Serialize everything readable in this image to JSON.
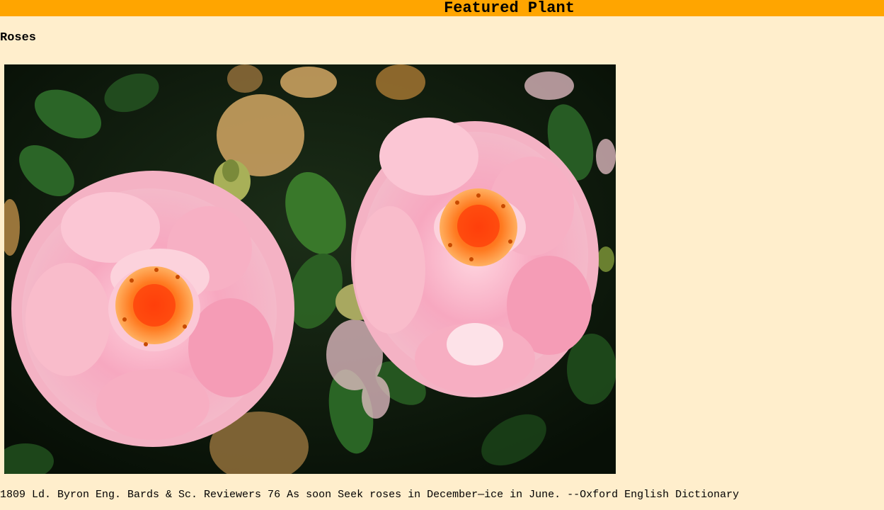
{
  "banner": {
    "title": "Featured Plant"
  },
  "plant": {
    "name": "Roses"
  },
  "image": {
    "subject": "roses-photo",
    "colors": {
      "petal": "#f7a8c0",
      "center": "#ff6a1a",
      "leaf": "#2e6a2a",
      "background": "#0c1a0c"
    }
  },
  "quote": {
    "text": "1809 Ld. Byron Eng. Bards & Sc. Reviewers 76 As soon Seek roses in December—ice in June. --Oxford English Dictionary"
  }
}
